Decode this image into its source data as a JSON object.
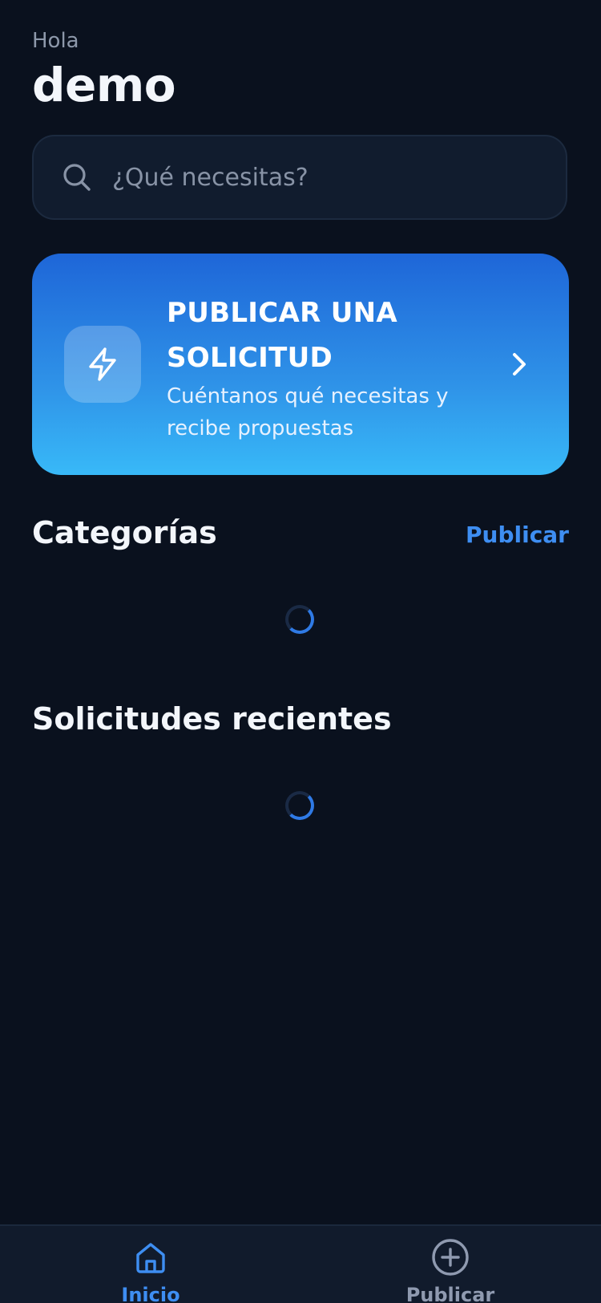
{
  "header": {
    "greeting": "Hola",
    "username": "demo"
  },
  "search": {
    "placeholder": "¿Qué necesitas?",
    "value": "",
    "icon": "search-icon"
  },
  "cta": {
    "title": "PUBLICAR UNA SOLICITUD",
    "subtitle": "Cuéntanos qué necesitas y recibe propuestas",
    "icon": "lightning-icon",
    "chevron_icon": "chevron-right-icon"
  },
  "categories": {
    "title": "Categorías",
    "action_label": "Publicar"
  },
  "recent": {
    "title": "Solicitudes recientes"
  },
  "tabbar": {
    "items": [
      {
        "label": "Inicio",
        "icon": "home-icon",
        "active": true
      },
      {
        "label": "Publicar",
        "icon": "plus-circle-icon",
        "active": false
      }
    ]
  },
  "colors": {
    "background": "#0a111e",
    "accent": "#3e8ef2",
    "cta_gradient_top": "#1e66d8",
    "cta_gradient_bottom": "#38b9f8"
  }
}
